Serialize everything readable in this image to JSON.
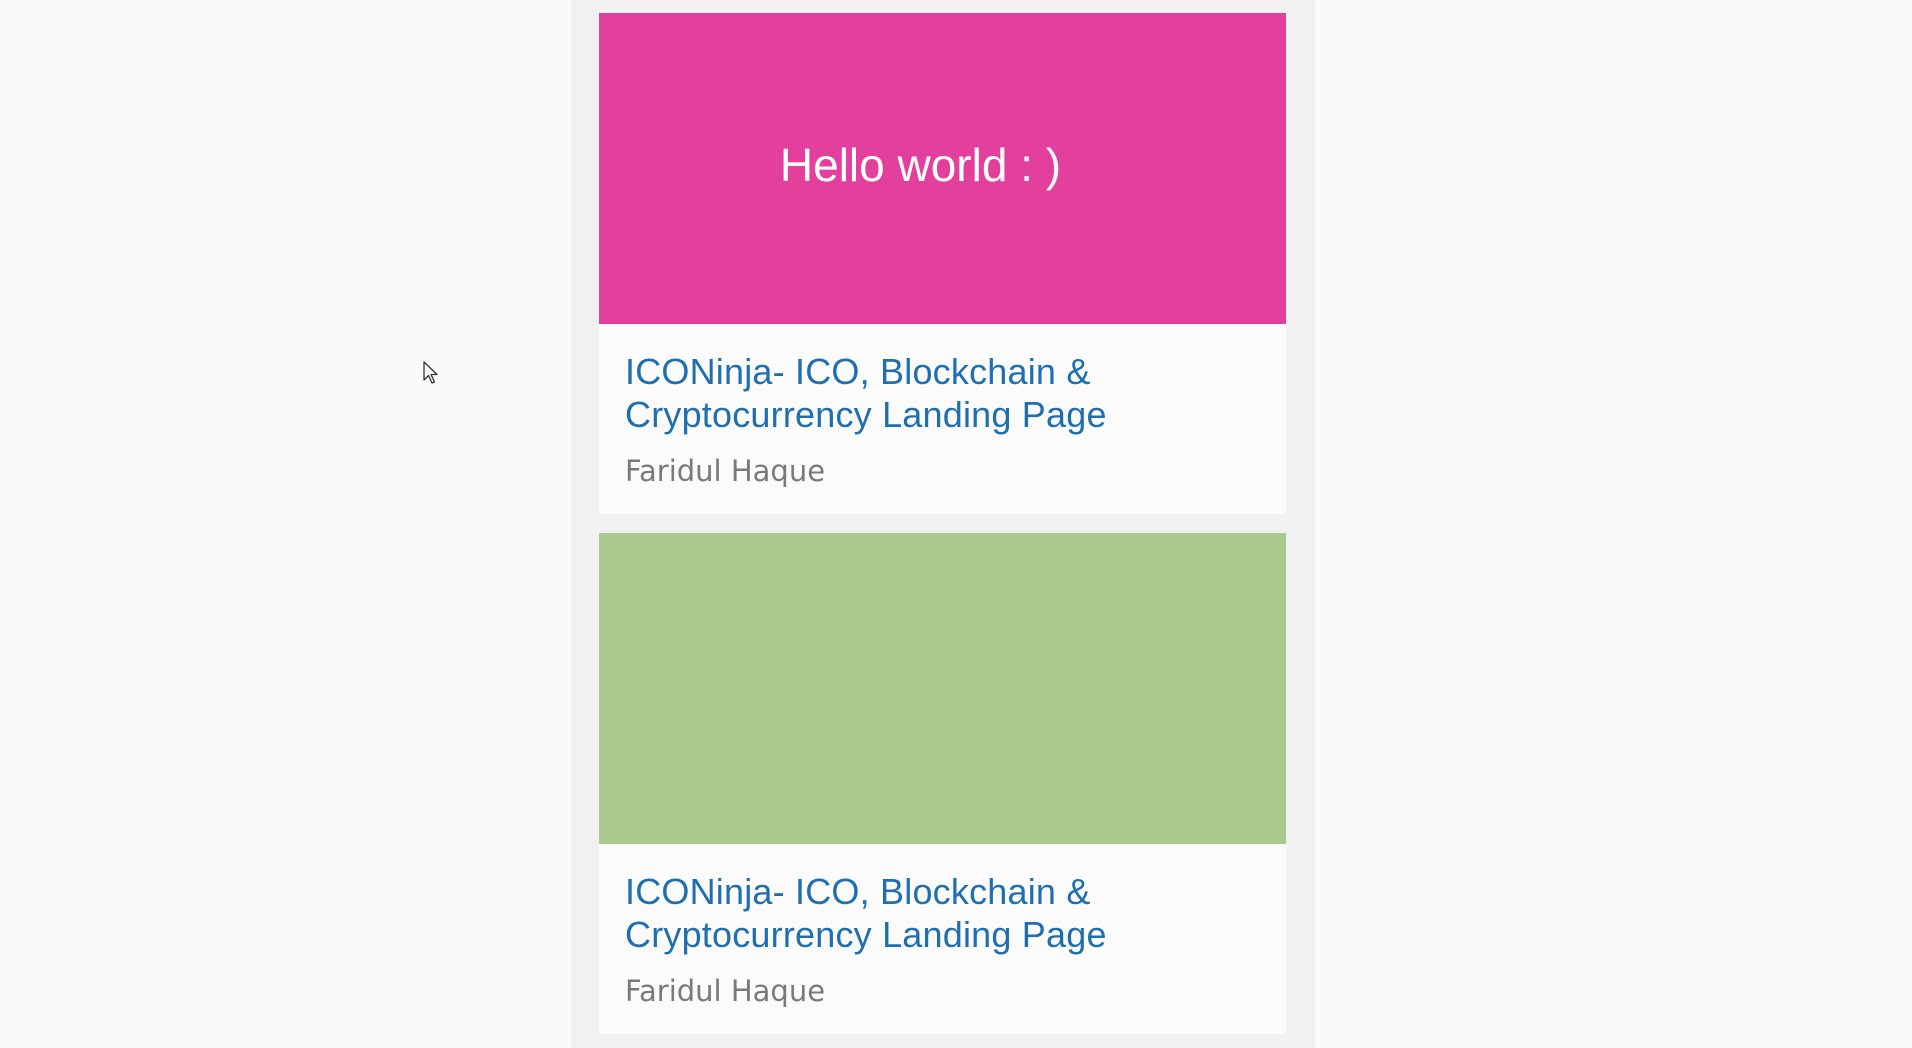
{
  "cards": [
    {
      "thumbnail_text": "Hello world : )",
      "thumbnail_color": "#e3409e",
      "title": "ICONinja- ICO, Blockchain & Cryptocurrency Landing Page",
      "author": "Faridul Haque"
    },
    {
      "thumbnail_text": "",
      "thumbnail_color": "#a9c98d",
      "title": "ICONinja- ICO, Blockchain & Cryptocurrency Landing Page",
      "author": "Faridul Haque"
    }
  ],
  "colors": {
    "background": "#fafafa",
    "column": "#f1f1f1",
    "title_link": "#1f6fb0",
    "author_text": "#7a7a7a"
  },
  "icons": {
    "cursor": "mouse-pointer-icon"
  }
}
